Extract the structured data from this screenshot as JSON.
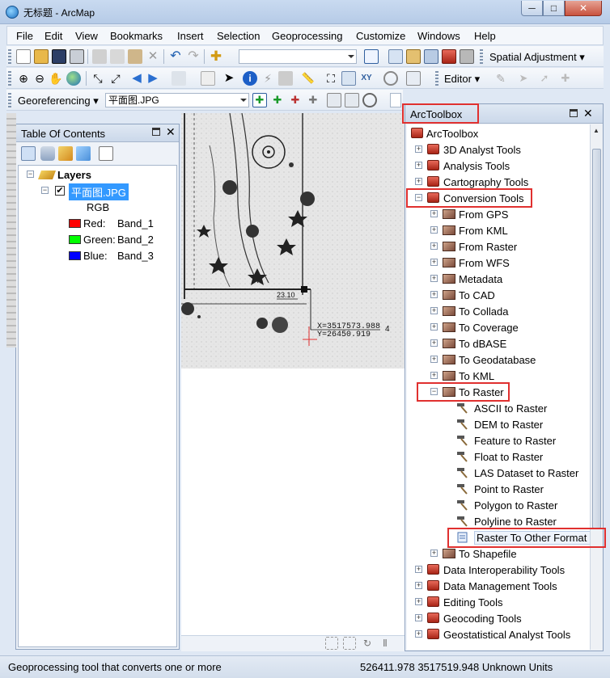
{
  "window": {
    "title": "无标题 - ArcMap",
    "min_label": "─",
    "max_label": "□",
    "close_label": "✕"
  },
  "menu": [
    "File",
    "Edit",
    "View",
    "Bookmarks",
    "Insert",
    "Selection",
    "Geoprocessing",
    "Customize",
    "Windows",
    "Help"
  ],
  "toolbar": {
    "spatial_adjustment": "Spatial Adjustment ▾",
    "editor": "Editor ▾",
    "georeferencing": "Georeferencing ▾",
    "layer_select": "平面图.JPG"
  },
  "toc": {
    "title": "Table Of Contents",
    "layers_label": "Layers",
    "layer_name": "平面图.JPG",
    "rgb_label": "RGB",
    "bands": [
      {
        "channel": "Red:",
        "band": "Band_1",
        "color": "#ff0000"
      },
      {
        "channel": "Green:",
        "band": "Band_2",
        "color": "#00ff00"
      },
      {
        "channel": "Blue:",
        "band": "Band_3",
        "color": "#0000ff"
      }
    ]
  },
  "map": {
    "label_2310": "23.10",
    "coord_x": "X=3517573.988",
    "coord_y": "Y=26450.919",
    "side_num": "4"
  },
  "toolbox": {
    "title": "ArcToolbox",
    "root": "ArcToolbox",
    "items": [
      {
        "label": "3D Analyst Tools",
        "level": 0,
        "kind": "toolbox",
        "exp": "+"
      },
      {
        "label": "Analysis Tools",
        "level": 0,
        "kind": "toolbox",
        "exp": "+"
      },
      {
        "label": "Cartography Tools",
        "level": 0,
        "kind": "toolbox",
        "exp": "+"
      },
      {
        "label": "Conversion Tools",
        "level": 0,
        "kind": "toolbox",
        "exp": "−"
      },
      {
        "label": "From GPS",
        "level": 1,
        "kind": "toolset",
        "exp": "+"
      },
      {
        "label": "From KML",
        "level": 1,
        "kind": "toolset",
        "exp": "+"
      },
      {
        "label": "From Raster",
        "level": 1,
        "kind": "toolset",
        "exp": "+"
      },
      {
        "label": "From WFS",
        "level": 1,
        "kind": "toolset",
        "exp": "+"
      },
      {
        "label": "Metadata",
        "level": 1,
        "kind": "toolset",
        "exp": "+"
      },
      {
        "label": "To CAD",
        "level": 1,
        "kind": "toolset",
        "exp": "+"
      },
      {
        "label": "To Collada",
        "level": 1,
        "kind": "toolset",
        "exp": "+"
      },
      {
        "label": "To Coverage",
        "level": 1,
        "kind": "toolset",
        "exp": "+"
      },
      {
        "label": "To dBASE",
        "level": 1,
        "kind": "toolset",
        "exp": "+"
      },
      {
        "label": "To Geodatabase",
        "level": 1,
        "kind": "toolset",
        "exp": "+"
      },
      {
        "label": "To KML",
        "level": 1,
        "kind": "toolset",
        "exp": "+"
      },
      {
        "label": "To Raster",
        "level": 1,
        "kind": "toolset",
        "exp": "−"
      },
      {
        "label": "ASCII to Raster",
        "level": 2,
        "kind": "tool",
        "exp": ""
      },
      {
        "label": "DEM to Raster",
        "level": 2,
        "kind": "tool",
        "exp": ""
      },
      {
        "label": "Feature to Raster",
        "level": 2,
        "kind": "tool",
        "exp": ""
      },
      {
        "label": "Float to Raster",
        "level": 2,
        "kind": "tool",
        "exp": ""
      },
      {
        "label": "LAS Dataset to Raster",
        "level": 2,
        "kind": "tool",
        "exp": ""
      },
      {
        "label": "Point to Raster",
        "level": 2,
        "kind": "tool",
        "exp": ""
      },
      {
        "label": "Polygon to Raster",
        "level": 2,
        "kind": "tool",
        "exp": ""
      },
      {
        "label": "Polyline to Raster",
        "level": 2,
        "kind": "tool",
        "exp": ""
      },
      {
        "label": "Raster To Other Format (mul",
        "level": 2,
        "kind": "script",
        "exp": ""
      },
      {
        "label": "To Shapefile",
        "level": 1,
        "kind": "toolset",
        "exp": "+"
      },
      {
        "label": "Data Interoperability Tools",
        "level": 0,
        "kind": "toolbox",
        "exp": "+"
      },
      {
        "label": "Data Management Tools",
        "level": 0,
        "kind": "toolbox",
        "exp": "+"
      },
      {
        "label": "Editing Tools",
        "level": 0,
        "kind": "toolbox",
        "exp": "+"
      },
      {
        "label": "Geocoding Tools",
        "level": 0,
        "kind": "toolbox",
        "exp": "+"
      },
      {
        "label": "Geostatistical Analyst Tools",
        "level": 0,
        "kind": "toolbox",
        "exp": "+"
      }
    ]
  },
  "status": {
    "message": "Geoprocessing tool that converts one or more",
    "coords": "526411.978  3517519.948 Unknown Units"
  }
}
